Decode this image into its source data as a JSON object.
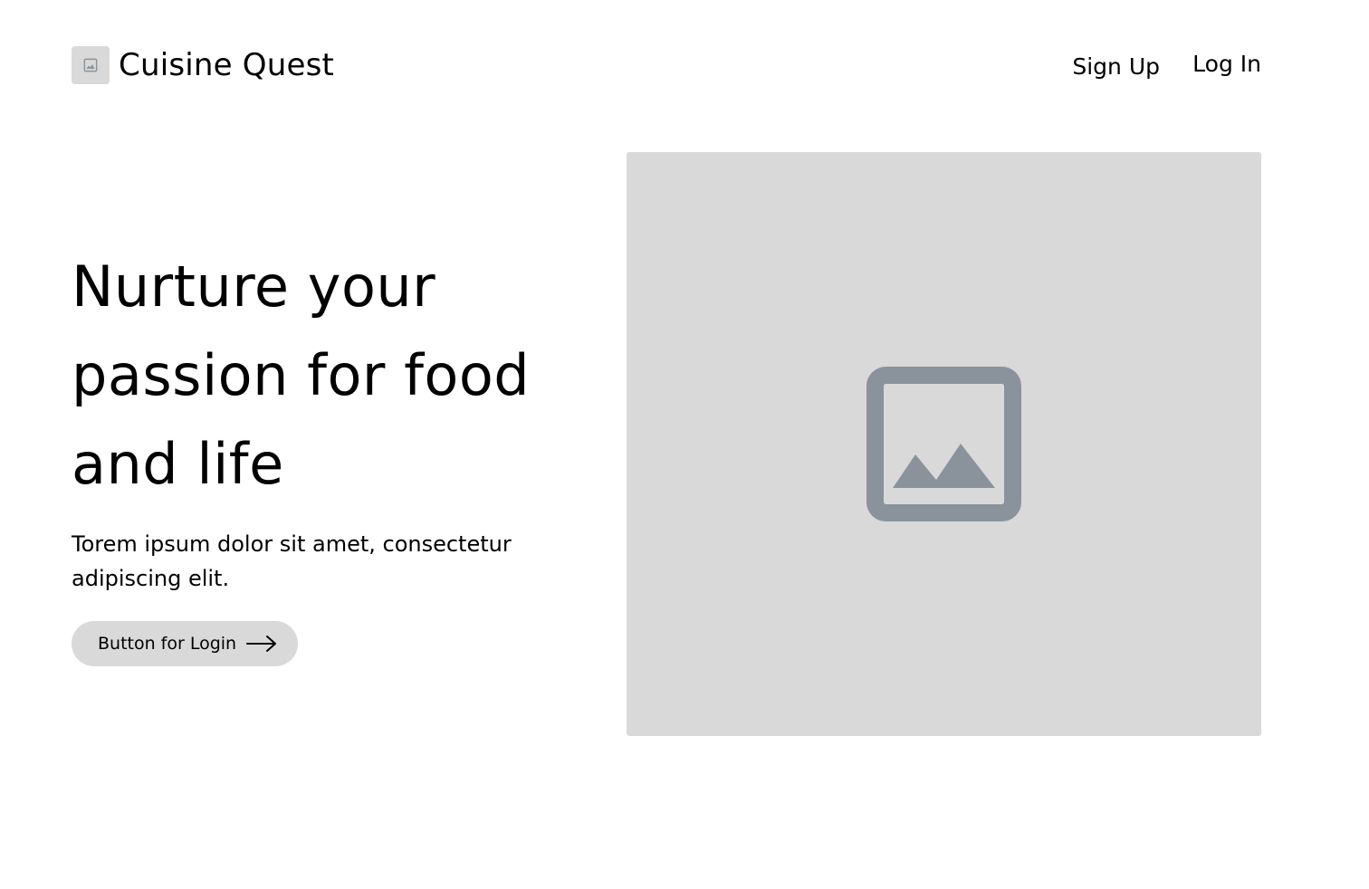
{
  "header": {
    "brand": "Cuisine Quest",
    "brand_icon": "image-placeholder-icon",
    "nav": {
      "signup_label": "Sign Up",
      "login_label": "Log In"
    }
  },
  "hero": {
    "title": "Nurture your passion for food and life",
    "description": "Torem ipsum dolor sit amet, consectetur adipiscing elit.",
    "cta_label": "Button for Login",
    "cta_icon": "arrow-right-icon",
    "image_icon": "image-placeholder-icon"
  },
  "colors": {
    "placeholder_bg": "#d9d9d9",
    "placeholder_icon": "#8a939b",
    "text": "#000000",
    "background": "#ffffff"
  }
}
